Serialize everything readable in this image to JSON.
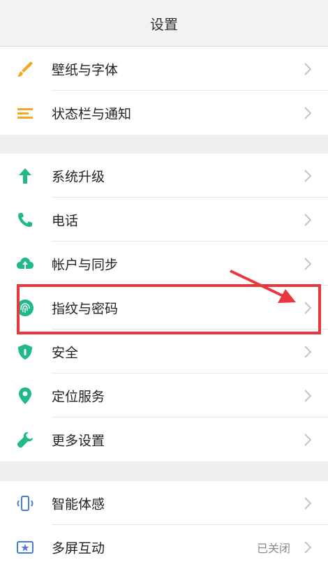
{
  "header": {
    "title": "设置"
  },
  "groups": [
    {
      "items": [
        {
          "label": "壁纸与字体",
          "icon": "brush-icon",
          "color": "#f5a623"
        },
        {
          "label": "状态栏与通知",
          "icon": "list-icon",
          "color": "#f5a623"
        }
      ]
    },
    {
      "items": [
        {
          "label": "系统升级",
          "icon": "arrow-up-icon",
          "color": "#1fb98a"
        },
        {
          "label": "电话",
          "icon": "phone-icon",
          "color": "#1fb98a"
        },
        {
          "label": "帐户与同步",
          "icon": "cloud-sync-icon",
          "color": "#1fb98a"
        },
        {
          "label": "指纹与密码",
          "icon": "fingerprint-icon",
          "color": "#1fb98a"
        },
        {
          "label": "安全",
          "icon": "shield-icon",
          "color": "#1fb98a"
        },
        {
          "label": "定位服务",
          "icon": "location-pin-icon",
          "color": "#1fb98a"
        },
        {
          "label": "更多设置",
          "icon": "wrench-icon",
          "color": "#1fb98a"
        }
      ]
    },
    {
      "items": [
        {
          "label": "智能体感",
          "icon": "phone-motion-icon",
          "color": "#4a7bd8"
        },
        {
          "label": "多屏互动",
          "icon": "screen-cast-icon",
          "color": "#4a7bd8",
          "status": "已关闭"
        }
      ]
    }
  ],
  "annotation": {
    "highlight_color": "#e8383e"
  }
}
